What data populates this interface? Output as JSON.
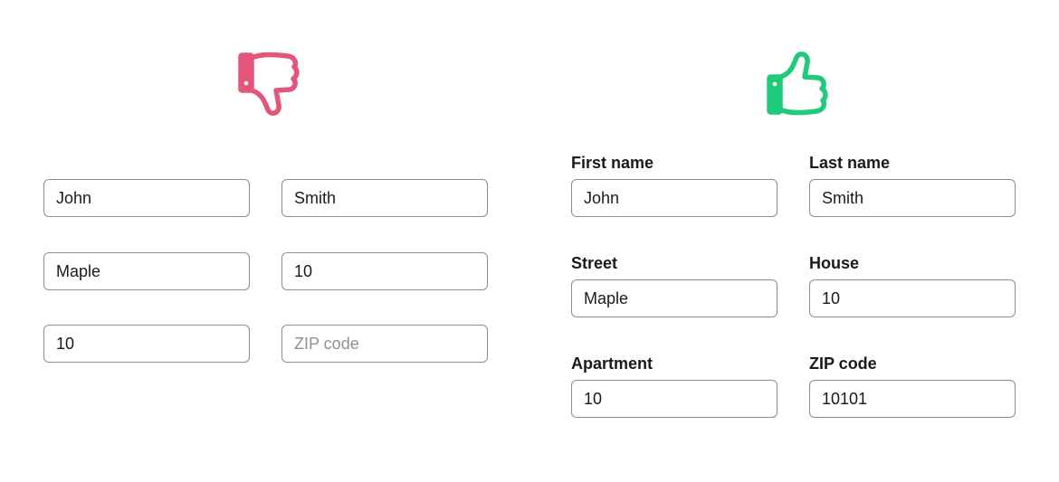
{
  "colors": {
    "bad_icon": "#E4557A",
    "good_icon": "#1FCB7A",
    "field_border": "#8C8C8C",
    "placeholder_text": "#8F8F8F"
  },
  "bad_example": {
    "icon": "thumbs-down-icon",
    "fields": {
      "first_name_value": "John",
      "last_name_value": "Smith",
      "street_value": "Maple",
      "house_value": "10",
      "apartment_value": "10",
      "zip_placeholder": "ZIP code"
    }
  },
  "good_example": {
    "icon": "thumbs-up-icon",
    "first_name": {
      "label": "First name",
      "value": "John"
    },
    "last_name": {
      "label": "Last name",
      "value": "Smith"
    },
    "street": {
      "label": "Street",
      "value": "Maple"
    },
    "house": {
      "label": "House",
      "value": "10"
    },
    "apartment": {
      "label": "Apartment",
      "value": "10"
    },
    "zip": {
      "label": "ZIP code",
      "value": "10101"
    }
  }
}
